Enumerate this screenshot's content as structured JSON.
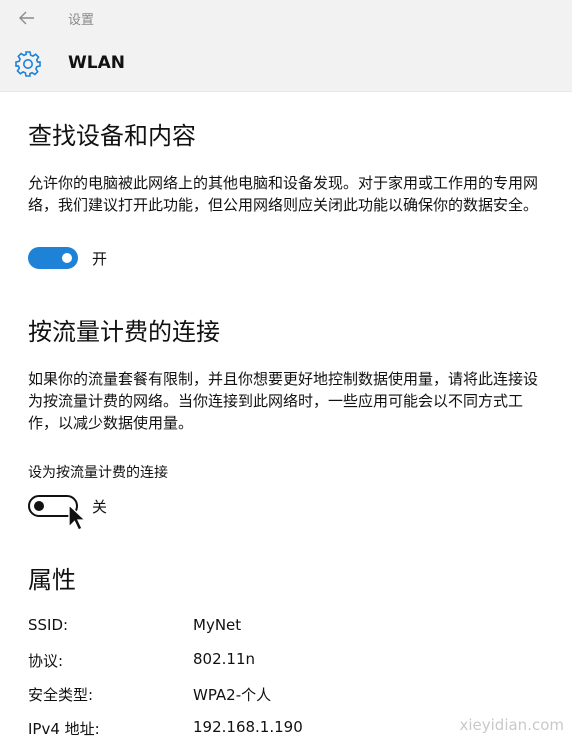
{
  "window": {
    "app_title": "设置",
    "back_icon": "back-arrow-icon"
  },
  "header": {
    "icon": "gear-icon",
    "title": "WLAN",
    "accent": "#1e82d7"
  },
  "find_devices": {
    "title": "查找设备和内容",
    "description": "允许你的电脑被此网络上的其他电脑和设备发现。对于家用或工作用的专用网络，我们建议打开此功能，但公用网络则应关闭此功能以确保你的数据安全。",
    "toggle_on": true,
    "toggle_state": "开"
  },
  "metered": {
    "title": "按流量计费的连接",
    "description": "如果你的流量套餐有限制，并且你想要更好地控制数据使用量，请将此连接设为按流量计费的网络。当你连接到此网络时，一些应用可能会以不同方式工作，以减少数据使用量。",
    "setting_label": "设为按流量计费的连接",
    "toggle_on": false,
    "toggle_state": "关"
  },
  "properties": {
    "title": "属性",
    "rows": [
      {
        "key": "SSID:",
        "value": "MyNet"
      },
      {
        "key": "协议:",
        "value": "802.11n"
      },
      {
        "key": "安全类型:",
        "value": "WPA2-个人"
      },
      {
        "key": "IPv4 地址:",
        "value": "192.168.1.190"
      }
    ]
  },
  "watermark": "xieyidian.com"
}
